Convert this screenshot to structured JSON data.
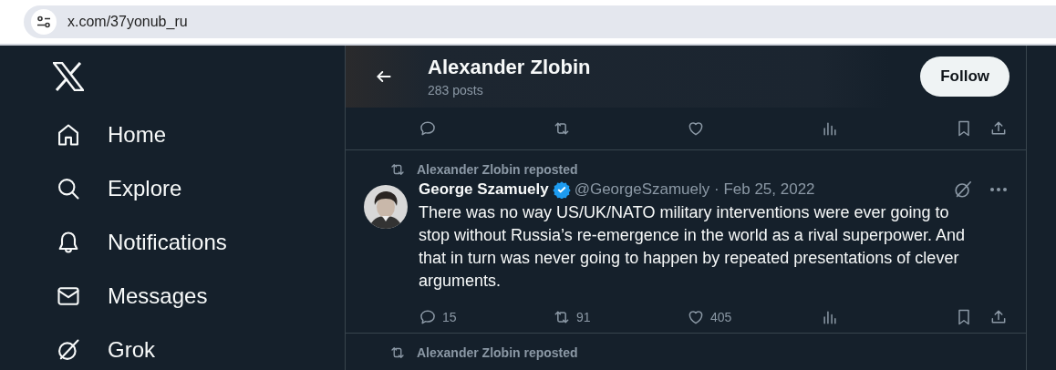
{
  "browser": {
    "url": "x.com/37yonub_ru"
  },
  "sidebar": {
    "items": [
      {
        "label": "Home"
      },
      {
        "label": "Explore"
      },
      {
        "label": "Notifications"
      },
      {
        "label": "Messages"
      },
      {
        "label": "Grok"
      }
    ]
  },
  "header": {
    "title": "Alexander Zlobin",
    "subtitle": "283 posts",
    "follow_button": "Follow"
  },
  "posts": [
    {
      "kind": "actions-only"
    },
    {
      "kind": "full",
      "repost_label": "Alexander Zlobin reposted",
      "author": "George Szamuely",
      "verified": true,
      "meta": "@GeorgeSzamuely · Feb 25, 2022",
      "text": "There was no way US/UK/NATO military interventions were ever going to stop without Russia’s re-emergence in the world as a rival superpower. And that in turn was never going to happen by repeated presentations of clever arguments.",
      "replies": "15",
      "reposts": "91",
      "likes": "405"
    },
    {
      "kind": "repost-line",
      "repost_label": "Alexander Zlobin reposted"
    }
  ]
}
